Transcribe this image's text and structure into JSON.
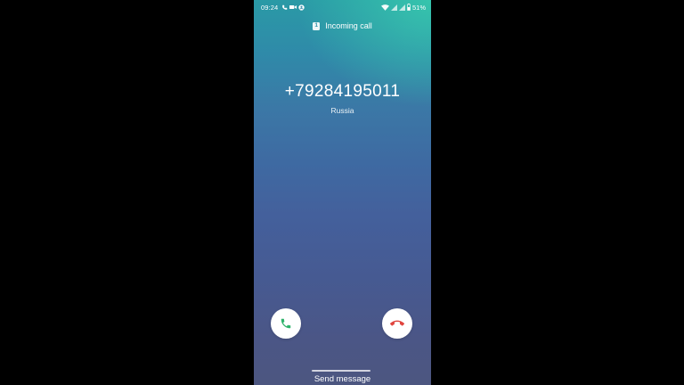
{
  "status_bar": {
    "time": "09:24",
    "battery": "51%",
    "left_icons": [
      "call-forward-icon",
      "video-icon",
      "account-icon"
    ],
    "right_icons": [
      "wifi-icon",
      "signal-icon",
      "signal-icon",
      "battery-icon"
    ]
  },
  "call": {
    "sim_slot": "1",
    "header": "Incoming call",
    "number": "+79284195011",
    "location": "Russia"
  },
  "actions": {
    "accept_icon": "phone-accept-icon",
    "decline_icon": "phone-decline-icon",
    "send_message": "Send message"
  },
  "colors": {
    "accept": "#2fb36b",
    "decline": "#e0453f",
    "background_top": "#38ccae",
    "background_bottom": "#4c5680"
  }
}
